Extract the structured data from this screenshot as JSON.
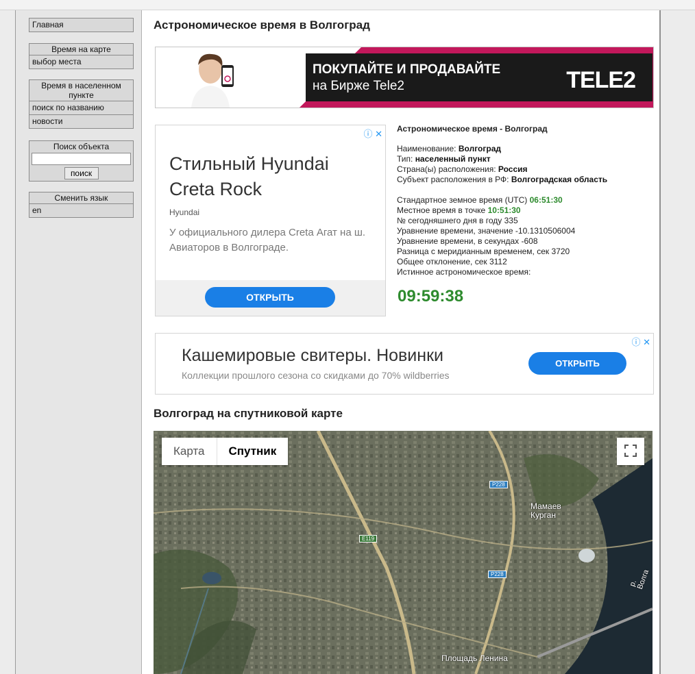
{
  "sidebar": {
    "home": "Главная",
    "map_box": {
      "header": "Время на карте",
      "item": "выбор места"
    },
    "city_box": {
      "header": "Время в населенном пункте",
      "items": [
        "поиск по названию",
        "новости"
      ]
    },
    "search_box": {
      "header": "Поиск объекта",
      "input_value": "",
      "button": "поиск"
    },
    "lang_box": {
      "header": "Сменить язык",
      "item": "en"
    }
  },
  "page": {
    "title": "Астрономическое время в Волгоград",
    "map_title": "Волгоград на спутниковой карте"
  },
  "ads": {
    "tele2": {
      "line1": "ПОКУПАЙТЕ И ПРОДАВАЙТЕ",
      "line2": "на Бирже Tele2",
      "logo": "TELE2"
    },
    "hyundai": {
      "title": "Стильный Hyundai Creta Rock",
      "brand": "Hyundai",
      "desc": "У официального дилера Creta Агат на ш. Авиаторов в Волгограде.",
      "button": "ОТКРЫТЬ"
    },
    "wb": {
      "title": "Кашемировые свитеры. Новинки",
      "sub": "Коллекции прошлого сезона со скидками до 70% wildberries",
      "button": "ОТКРЫТЬ"
    }
  },
  "info": {
    "title": "Астрономическое время - Волгоград",
    "name_label": "Наименование:",
    "name_value": "Волгоград",
    "type_label": "Тип:",
    "type_value": "населенный пункт",
    "country_label": "Страна(ы) расположения:",
    "country_value": "Россия",
    "region_label": "Субъект расположения в РФ:",
    "region_value": "Волгоградская область",
    "utc_label": "Стандартное земное время (UTC)",
    "utc_value": "06:51:30",
    "local_label": "Местное время в точке",
    "local_value": "10:51:30",
    "day_label": "№ сегодняшнего дня в году",
    "day_value": "335",
    "eq_label": "Уравнение времени, значение",
    "eq_value": "-10.1310506004",
    "eqs_label": "Уравнение времени, в секундах",
    "eqs_value": "-608",
    "mer_label": "Разница с меридианным временем, сек",
    "mer_value": "3720",
    "dev_label": "Общее отклонение, сек",
    "dev_value": "3112",
    "true_label": "Истинное астрономическое время:",
    "true_value": "09:59:38"
  },
  "map": {
    "type_map": "Карта",
    "type_sat": "Спутник",
    "labels": {
      "mamaev": "Мамаев Курган",
      "ploshchad": "Площадь Ленина",
      "volga": "р. Волга",
      "r228a": "P228",
      "r228b": "P228",
      "e119": "E119"
    }
  },
  "colors": {
    "green_time": "#2e8b2e",
    "ad_button": "#1a7fe6",
    "tele2_pink": "#c2185b"
  }
}
